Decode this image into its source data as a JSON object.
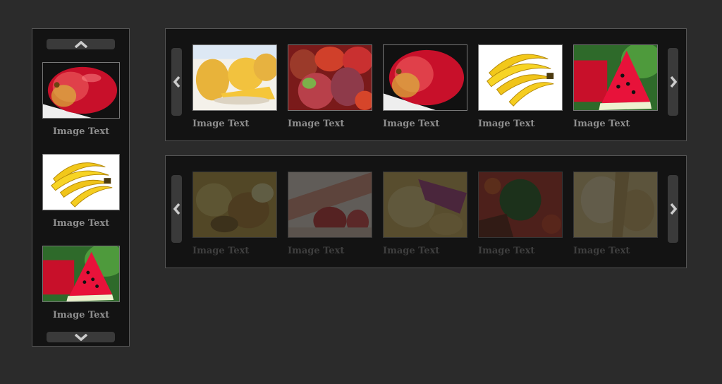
{
  "vertical_carousel": {
    "up_icon": "chevron-up-icon",
    "down_icon": "chevron-down-icon",
    "items": [
      {
        "caption": "Image Text",
        "image": "apple"
      },
      {
        "caption": "Image Text",
        "image": "bananas"
      },
      {
        "caption": "Image Text",
        "image": "watermelon"
      }
    ]
  },
  "carousel_top": {
    "prev_icon": "chevron-left-icon",
    "next_icon": "chevron-right-icon",
    "items": [
      {
        "caption": "Image Text",
        "image": "mango-slices"
      },
      {
        "caption": "Image Text",
        "image": "mangoes"
      },
      {
        "caption": "Image Text",
        "image": "apple"
      },
      {
        "caption": "Image Text",
        "image": "bananas"
      },
      {
        "caption": "Image Text",
        "image": "watermelon"
      }
    ]
  },
  "carousel_bottom": {
    "prev_icon": "chevron-left-icon",
    "next_icon": "chevron-right-icon",
    "items": [
      {
        "caption": "Image Text",
        "image": "food-dish"
      },
      {
        "caption": "Image Text",
        "image": "food-dish"
      },
      {
        "caption": "Image Text",
        "image": "food-dish"
      },
      {
        "caption": "Image Text",
        "image": "food-dish"
      },
      {
        "caption": "Image Text",
        "image": "food-dish"
      }
    ]
  },
  "colors": {
    "background": "#2b2b2b",
    "panel": "#131313",
    "border": "#555555",
    "caption": "#8e8e8e",
    "arrow": "#cccccc"
  }
}
